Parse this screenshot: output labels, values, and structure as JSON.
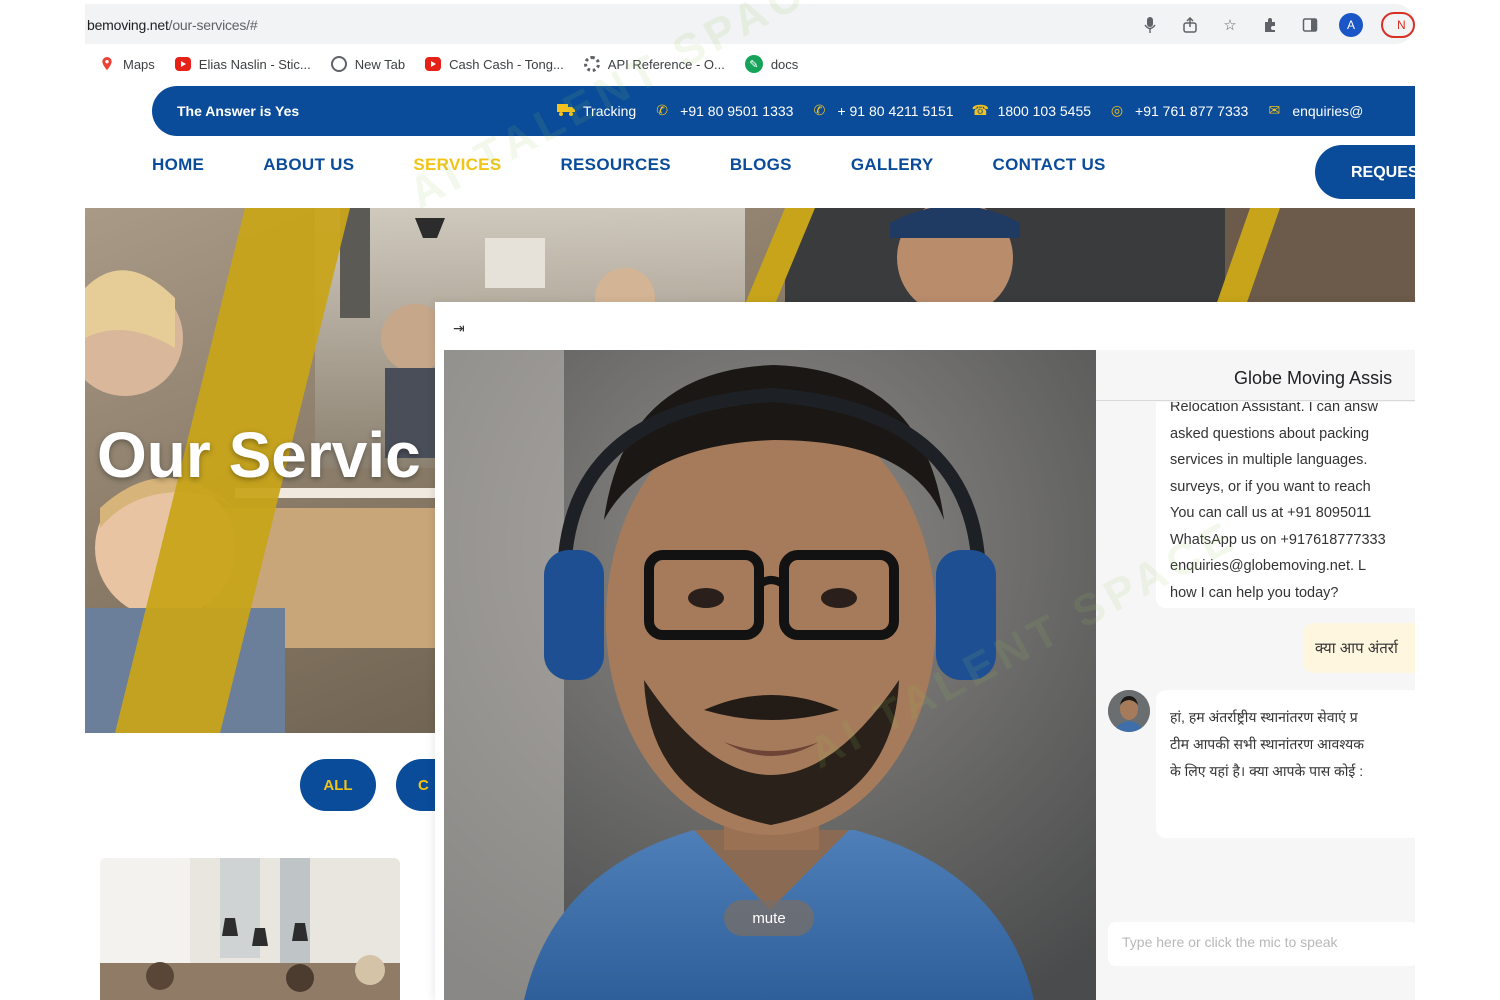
{
  "browser": {
    "url_host": "bemoving.net",
    "url_path": "/our-services/#",
    "avatar_letter": "A",
    "new_badge": "N",
    "bookmarks": [
      {
        "label": "Maps",
        "icon": "maps-pin-icon"
      },
      {
        "label": "Elias Naslin - Stic...",
        "icon": "youtube-icon"
      },
      {
        "label": "New Tab",
        "icon": "globe-icon"
      },
      {
        "label": "Cash Cash - Tong...",
        "icon": "youtube-icon"
      },
      {
        "label": "API Reference - O...",
        "icon": "openai-icon"
      },
      {
        "label": "docs",
        "icon": "docs-icon"
      }
    ]
  },
  "topbar": {
    "tagline": "The Answer is Yes",
    "tracking": "Tracking",
    "phone1": "+91 80 9501 1333",
    "phone2": "+ 91 80 4211 5151",
    "tollfree": "1800 103 5455",
    "whatsapp": "+91 761 877 7333",
    "email": "enquiries@"
  },
  "nav": {
    "items": [
      "HOME",
      "ABOUT US",
      "SERVICES",
      "RESOURCES",
      "BLOGS",
      "GALLERY",
      "CONTACT US"
    ],
    "active_index": 2,
    "request_label": "REQUES"
  },
  "hero": {
    "title": "Our Servic"
  },
  "filters": {
    "all_label": "ALL",
    "second_label": "C"
  },
  "assistant": {
    "collapse_icon": "⇥",
    "mute_label": "mute",
    "title": "Globe Moving Assis",
    "bot_lines": [
      "Relocation Assistant. I can answ",
      "asked questions about packing",
      "services in multiple languages.",
      "surveys, or if you want to reach",
      "You can call us at +91 8095011",
      "WhatsApp us on +917618777333",
      "enquiries@globemoving.net. L",
      "how I can help you today?"
    ],
    "user_msg": "क्या आप अंतर्रा",
    "bot2_lines": [
      "हां, हम अंतर्राष्ट्रीय स्थानांतरण सेवाएं प्र",
      "टीम आपकी सभी स्थानांतरण आवश्यक",
      "के लिए यहां है। क्या आपके पास कोई :"
    ],
    "input_placeholder": "Type here or click the mic to speak"
  },
  "colors": {
    "brand_blue": "#0a4c9a",
    "brand_yellow": "#f2c416"
  }
}
